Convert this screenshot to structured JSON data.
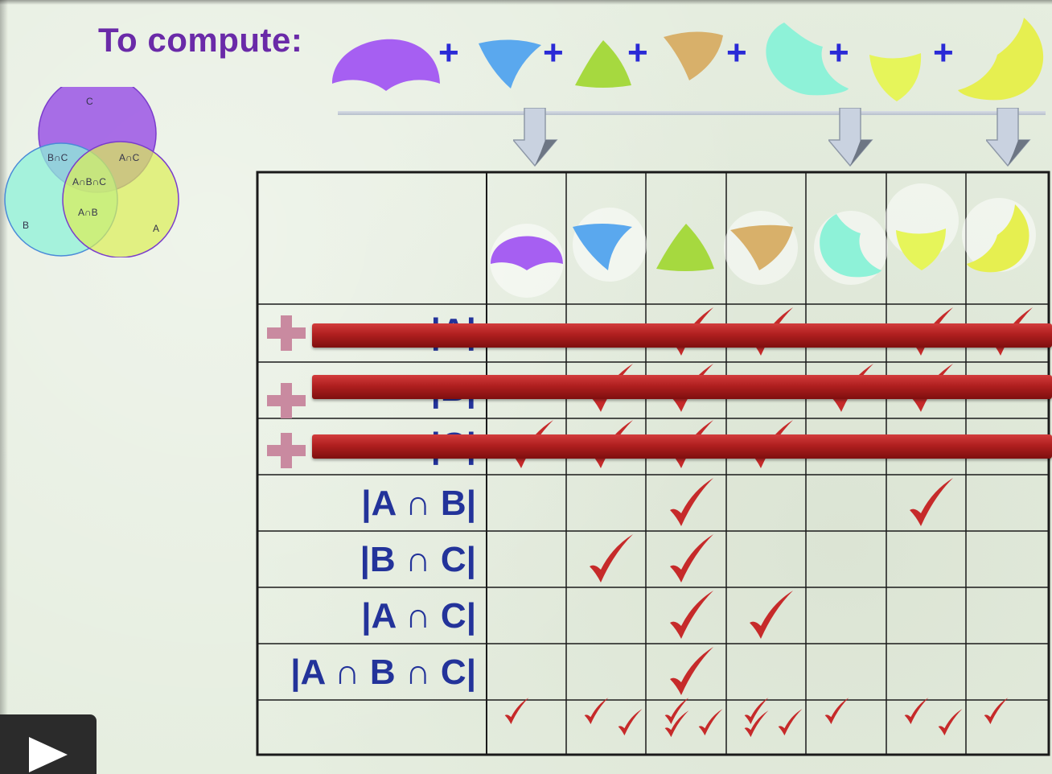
{
  "slide": {
    "title": "To compute:",
    "venn": {
      "set_labels": {
        "c": "C",
        "b": "B",
        "a": "A"
      },
      "region_labels": {
        "b_and_c": "B∩C",
        "a_and_c": "A∩C",
        "a_and_b_and_c": "A∩B∩C",
        "a_and_b": "A∩B"
      },
      "colors": {
        "c": "#a05ee6",
        "b": "#8ef2d8",
        "a": "#dcee55"
      }
    },
    "formula": {
      "plus_symbol": "+",
      "piece_colors": [
        "#a65ff2",
        "#5aa8ee",
        "#a6d93f",
        "#d8b06a",
        "#8ef2d8",
        "#e6f55a",
        "#e6ef50"
      ]
    },
    "table": {
      "rows": [
        {
          "label": "|A|",
          "struck": true,
          "checks": [
            false,
            false,
            true,
            true,
            false,
            true,
            true
          ]
        },
        {
          "label": "|B|",
          "struck": true,
          "checks": [
            false,
            true,
            true,
            false,
            true,
            true,
            false
          ]
        },
        {
          "label": "|C|",
          "struck": true,
          "checks": [
            true,
            true,
            true,
            true,
            false,
            false,
            false
          ]
        },
        {
          "label": "|A ∩ B|",
          "struck": false,
          "checks": [
            false,
            false,
            true,
            false,
            false,
            true,
            false
          ]
        },
        {
          "label": "|B ∩ C|",
          "struck": false,
          "checks": [
            false,
            true,
            true,
            false,
            false,
            false,
            false
          ]
        },
        {
          "label": "|A ∩ C|",
          "struck": false,
          "checks": [
            false,
            false,
            true,
            true,
            false,
            false,
            false
          ]
        },
        {
          "label": "|A ∩ B ∩ C|",
          "struck": false,
          "checks": [
            false,
            false,
            true,
            false,
            false,
            false,
            false
          ]
        }
      ],
      "summary_check_counts": [
        1,
        2,
        3,
        3,
        1,
        2,
        1
      ],
      "check_color": "#c62a2a",
      "crossbar_color": "#b01f1f",
      "plus_color": "#c98aa0"
    },
    "colors": {
      "title": "#6a2aa8",
      "row_label": "#23339a",
      "plus_sign": "#2a2ad6"
    }
  },
  "player": {
    "play_icon": "play-icon"
  }
}
